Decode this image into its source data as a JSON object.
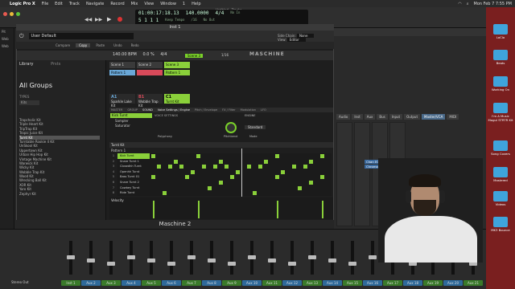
{
  "menubar": {
    "app": "Logic Pro X",
    "items": [
      "File",
      "Edit",
      "Track",
      "Navigate",
      "Record",
      "Mix",
      "View",
      "Window",
      "1",
      "Help"
    ],
    "clock": "Mon Feb 7  7:55 PM"
  },
  "lcd": {
    "position": "01:00:17:18.13",
    "bars": "5  1  1  1",
    "tempo": "140.0000",
    "tempo_mode": "Keep Tempo",
    "signature": "4/4",
    "division": "/16",
    "in_label": "No In",
    "out_label": "No Out"
  },
  "logic": {
    "window_title": "Untitled - Tracks",
    "plugin_window_title": "Inst 1",
    "left_strip": [
      "Pit",
      "Web",
      "Web"
    ]
  },
  "maschine": {
    "title": "Maschine 2",
    "preset": "User Default",
    "side_chain_label": "Side Chain:",
    "side_chain_value": "None",
    "view_label": "View:",
    "view_value": "Editor",
    "buttons": [
      "Compare",
      "Copy",
      "Paste",
      "Undo",
      "Redo"
    ],
    "bpm": "140.00 BPM",
    "swing": "0.0 %",
    "signature": "4/4",
    "scene_tag": "Scene 3",
    "position": "1/16",
    "brand": "MASCHINE",
    "library": {
      "title": "Library",
      "tab2": "Prsts",
      "heading": "All Groups",
      "types_label": "TYPES",
      "search": "Kits",
      "items": [
        "Trapcholic Kit",
        "Triple Heart Kit",
        "TripTrap Kit",
        "Tropic Juice Kit",
        "Turnt Kit",
        "Turntable Rookie 4 Kit",
        "UnSkool Kit",
        "Uppertown Kit",
        "Urban Hip Hop Kit",
        "Vintage Machine Kit",
        "Warwick Kit",
        "Wicky Kit",
        "Wobble Trap Kit",
        "Wood Kit",
        "Wrecking Ball Kit",
        "XOR Kit",
        "Yaro Kit",
        "Zephyr Kit"
      ],
      "selected_index": 4
    },
    "scenes": [
      "Scene 1",
      "Scene 2",
      "Scene 3"
    ],
    "patterns": [
      "Pattern 1",
      "",
      "Pattern 1"
    ],
    "groups": [
      {
        "id": "A1",
        "name": "Sparkle Lake Kit"
      },
      {
        "id": "B1",
        "name": "Wobble Trap Kit"
      },
      {
        "id": "C1",
        "name": "Turnt Kit"
      }
    ],
    "tabs": [
      "MASTER",
      "GROUP",
      "SOUND",
      "Voice Settings / Engine",
      "Pitch / Envelope",
      "FX / Filter",
      "Modulation",
      "LFO"
    ],
    "sound": {
      "name": "Kick Turnt",
      "plugins": [
        "Sampler",
        "Saturator"
      ],
      "voice_settings": "VOICE SETTINGS",
      "polyphony": "Polyphony",
      "pitchbend": "Pitchbend",
      "engine": "ENGINE",
      "mode_label": "Mode",
      "mode": "Standard"
    },
    "pattern_name": "Turnt Kit",
    "pattern_label": "Pattern 1",
    "rows": [
      {
        "num": "1",
        "name": "Kick Turnt"
      },
      {
        "num": "2",
        "name": "Snare Turnt 1"
      },
      {
        "num": "3",
        "name": "Closedhh Turnt"
      },
      {
        "num": "4",
        "name": "Openhh Turnt"
      },
      {
        "num": "5",
        "name": "Bass Turnt 01"
      },
      {
        "num": "6",
        "name": "Snare Turnt 2"
      },
      {
        "num": "7",
        "name": "Cowbey Turnt"
      },
      {
        "num": "8",
        "name": "Ride Turnt"
      }
    ],
    "velocity_label": "Velocity"
  },
  "inspector": {
    "tabs": [
      "Audio",
      "Inst",
      "Aux",
      "Bus",
      "Input",
      "Output",
      "Master/VCA",
      "MIDI"
    ],
    "plugin_slots": [
      "Chan EQ",
      "Chroma"
    ]
  },
  "mixer": {
    "labels": [
      "Inst 1",
      "Aux 2",
      "Aux 3",
      "Aux 4",
      "Aux 5",
      "Aux 6",
      "Aux 7",
      "Aux 8",
      "Aux 9",
      "Aux 10",
      "Aux 11",
      "Aux 12",
      "Aux 13",
      "Aux 14",
      "Aux 15",
      "Aux 16",
      "Aux 17",
      "Aux 18",
      "Aux 19",
      "Aux 20",
      "Aux 21"
    ],
    "stereo_out": "Stereo Out"
  },
  "desktop": {
    "items": [
      {
        "label": "LoClo"
      },
      {
        "label": "Beats"
      },
      {
        "label": "Working On"
      },
      {
        "label": "I'm A Music Mogul STRTR Kit"
      },
      {
        "label": "Song Covers"
      },
      {
        "label": "Mastered"
      },
      {
        "label": "Videos"
      },
      {
        "label": "MK3 Bounce"
      }
    ]
  },
  "colors": {
    "maschine_green": "#8ad03a",
    "folder_blue": "#3fa4dc",
    "desktop_red": "#7a1f1f"
  }
}
